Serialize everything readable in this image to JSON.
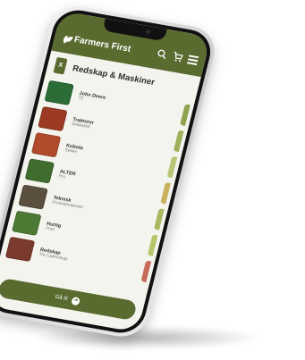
{
  "header": {
    "brand": "Farmers First"
  },
  "page": {
    "badge": "X",
    "title": "Redskap & Maskiner"
  },
  "list": [
    {
      "name": "John Deere",
      "sub": "TE",
      "thumb_color": "#2c6c36",
      "tab_color": "#8fa24e"
    },
    {
      "name": "Traktorer",
      "sub": "Sekkekrill",
      "thumb_color": "#9b3b24",
      "tab_color": "#9fb05a"
    },
    {
      "name": "Kubota",
      "sub": "Sekke",
      "thumb_color": "#b04b2c",
      "tab_color": "#b9c474"
    },
    {
      "name": "ALTER",
      "sub": "Pro",
      "thumb_color": "#3f6d2e",
      "tab_color": "#c9b05c"
    },
    {
      "name": "Teknisk",
      "sub": "Produktmateriell",
      "thumb_color": "#5b4f3f",
      "tab_color": "#a6b95f"
    },
    {
      "name": "Hurtig",
      "sub": "Prod",
      "thumb_color": "#4d7a35",
      "tab_color": "#b8c56d"
    },
    {
      "name": "Redskap",
      "sub": "Tre Gallenskap",
      "thumb_color": "#7b3a2e",
      "tab_color": "#c76b5b"
    }
  ],
  "footer": {
    "label": "Gå til"
  },
  "colors": {
    "brand": "#5a6b2f"
  },
  "icons": {
    "search": "search-icon",
    "cart": "cart-icon",
    "menu": "menu-icon",
    "arrow": "arrow-right-icon"
  }
}
